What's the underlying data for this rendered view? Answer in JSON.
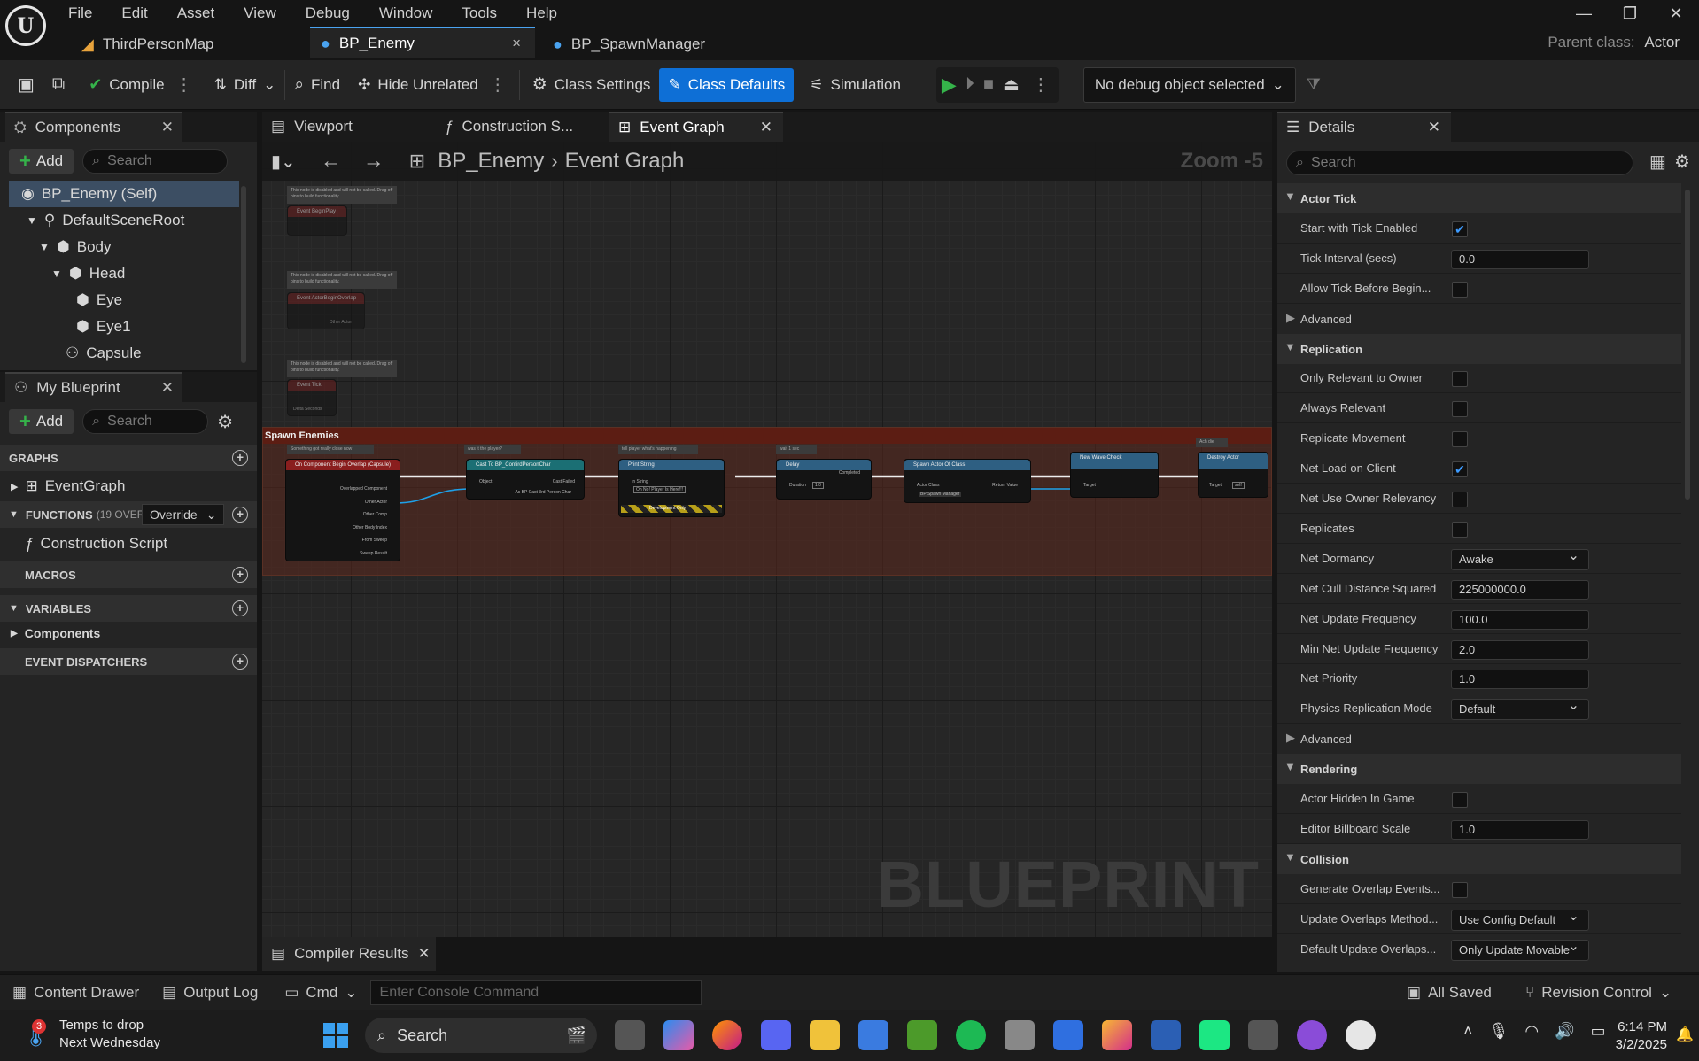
{
  "menu": [
    "File",
    "Edit",
    "Asset",
    "View",
    "Debug",
    "Window",
    "Tools",
    "Help"
  ],
  "doc_tabs": [
    {
      "label": "ThirdPersonMap"
    },
    {
      "label": "BP_Enemy",
      "close": "×"
    },
    {
      "label": "BP_SpawnManager"
    }
  ],
  "parent_class": {
    "label": "Parent class:",
    "value": "Actor"
  },
  "toolbar": {
    "compile": "Compile",
    "diff": "Diff",
    "find": "Find",
    "hide_unrelated": "Hide Unrelated",
    "class_settings": "Class Settings",
    "class_defaults": "Class Defaults",
    "simulation": "Simulation",
    "debug_object": "No debug object selected"
  },
  "components": {
    "tab": "Components",
    "add": "Add",
    "search_placeholder": "Search",
    "tree": [
      "BP_Enemy (Self)",
      "DefaultSceneRoot",
      "Body",
      "Head",
      "Eye",
      "Eye1",
      "Capsule"
    ]
  },
  "my_blueprint": {
    "tab": "My Blueprint",
    "add": "Add",
    "search_placeholder": "Search",
    "graphs": "GRAPHS",
    "event_graph": "EventGraph",
    "functions": "FUNCTIONS",
    "functions_count": "(19 OVERR",
    "override": "Override",
    "construction_script": "Construction Script",
    "macros": "MACROS",
    "variables": "VARIABLES",
    "components": "Components",
    "dispatchers": "EVENT DISPATCHERS"
  },
  "graph_tabs": [
    {
      "label": "Viewport"
    },
    {
      "label": "Construction S..."
    },
    {
      "label": "Event Graph"
    }
  ],
  "graph": {
    "breadcrumb_root": "BP_Enemy",
    "breadcrumb_leaf": "Event Graph",
    "zoom": "Zoom -5",
    "watermark": "BLUEPRINT",
    "comment_box": "Spawn Enemies",
    "disabled_note": "This node is disabled and will not be called. Drag off pins to build functionality.",
    "disabled_nodes": [
      "Event BeginPlay",
      "Event ActorBeginOverlap",
      "Event Tick"
    ],
    "other_actor": "Other Actor",
    "delta_seconds": "Delta Seconds",
    "nodes": [
      {
        "title": "On Component Begin Overlap (Capsule)",
        "comment": "Something got really close now"
      },
      {
        "title": "Cast To BP_ConfirdPersonChar",
        "comment": "was it the player?"
      },
      {
        "title": "Print String",
        "comment": "tell player what's happening"
      },
      {
        "title": "Delay",
        "comment": "wait 1 sec"
      },
      {
        "title": "Spawn Actor Of Class",
        "comment": ""
      },
      {
        "title": "New Wave Check",
        "comment": ""
      },
      {
        "title": "Destroy Actor",
        "comment": "Ach die"
      }
    ],
    "pins": [
      "Overlapped Component",
      "Other Actor",
      "Other Comp",
      "Other Body Index",
      "From Sweep",
      "Sweep Result",
      "Object",
      "Cast Failed",
      "As BP Cast 3rd Person Char",
      "In String",
      "Development Only",
      "Duration",
      "Completed",
      "Actor Class",
      "Return Value",
      "Target",
      "Target"
    ],
    "print_value": "Oh No! Player Is Here!!!",
    "delay_value": "1.0",
    "spawn_class": "BP Spawn Manager",
    "self_value": "self"
  },
  "compiler_results": "Compiler Results",
  "details": {
    "tab": "Details",
    "search_placeholder": "Search",
    "rows": [
      {
        "type": "section",
        "label": "Actor Tick"
      },
      {
        "type": "check",
        "label": "Start with Tick Enabled",
        "checked": true
      },
      {
        "type": "text",
        "label": "Tick Interval (secs)",
        "value": "0.0"
      },
      {
        "type": "check",
        "label": "Allow Tick Before Begin...",
        "checked": false
      },
      {
        "type": "adv",
        "label": "Advanced"
      },
      {
        "type": "section",
        "label": "Replication"
      },
      {
        "type": "check",
        "label": "Only Relevant to Owner",
        "checked": false
      },
      {
        "type": "check",
        "label": "Always Relevant",
        "checked": false
      },
      {
        "type": "check",
        "label": "Replicate Movement",
        "checked": false
      },
      {
        "type": "check",
        "label": "Net Load on Client",
        "checked": true
      },
      {
        "type": "check",
        "label": "Net Use Owner Relevancy",
        "checked": false
      },
      {
        "type": "check",
        "label": "Replicates",
        "checked": false
      },
      {
        "type": "combo",
        "label": "Net Dormancy",
        "value": "Awake"
      },
      {
        "type": "text",
        "label": "Net Cull Distance Squared",
        "value": "225000000.0"
      },
      {
        "type": "text",
        "label": "Net Update Frequency",
        "value": "100.0"
      },
      {
        "type": "text",
        "label": "Min Net Update Frequency",
        "value": "2.0"
      },
      {
        "type": "text",
        "label": "Net Priority",
        "value": "1.0"
      },
      {
        "type": "combo",
        "label": "Physics Replication Mode",
        "value": "Default"
      },
      {
        "type": "adv",
        "label": "Advanced"
      },
      {
        "type": "section",
        "label": "Rendering"
      },
      {
        "type": "check",
        "label": "Actor Hidden In Game",
        "checked": false
      },
      {
        "type": "text",
        "label": "Editor Billboard Scale",
        "value": "1.0"
      },
      {
        "type": "section",
        "label": "Collision"
      },
      {
        "type": "check",
        "label": "Generate Overlap Events...",
        "checked": false
      },
      {
        "type": "combo",
        "label": "Update Overlaps Method...",
        "value": "Use Config Default"
      },
      {
        "type": "combo",
        "label": "Default Update Overlaps...",
        "value": "Only Update Movable"
      }
    ]
  },
  "statusbar": {
    "content_drawer": "Content Drawer",
    "output_log": "Output Log",
    "cmd": "Cmd",
    "console_placeholder": "Enter Console Command",
    "all_saved": "All Saved",
    "revision_control": "Revision Control"
  },
  "taskbar": {
    "weather_title": "Temps to drop",
    "weather_sub": "Next Wednesday",
    "weather_badge": "3",
    "search": "Search",
    "time": "6:14 PM",
    "date": "3/2/2025"
  }
}
